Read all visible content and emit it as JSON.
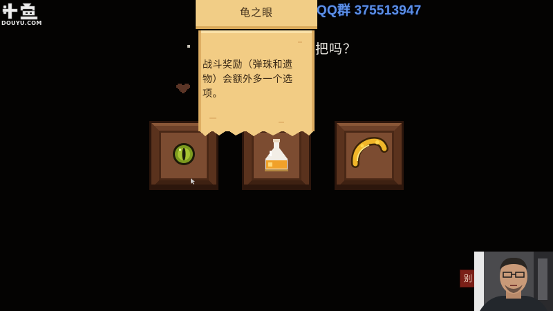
{
  "watermark": {
    "logo_text": "斗鱼",
    "domain_text": "DOUYU.COM"
  },
  "overlay": {
    "qq_group": "QQ群 375513947"
  },
  "dialog": {
    "question_visible": "把吗？"
  },
  "tooltip": {
    "title": "龟之眼",
    "description": "战斗奖励（弹珠和遗物）会额外多一个选项。"
  },
  "reward_chests": [
    {
      "item_icon": "green-eye-icon"
    },
    {
      "item_icon": "potion-bottle-icon"
    },
    {
      "item_icon": "golden-bracelet-icon"
    }
  ],
  "webcam": {
    "side_badge_text": "别"
  },
  "colors": {
    "background": "#040302",
    "scroll_paper": "#efc980",
    "scroll_text": "#3b2a17",
    "qq_text": "#5c8fe8",
    "chest_wood": "#7a4a2f",
    "chest_frame": "#4a2a18"
  }
}
